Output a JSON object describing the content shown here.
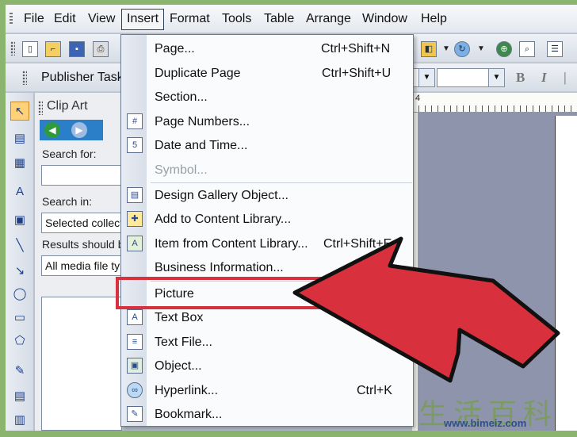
{
  "menubar": {
    "items": [
      "File",
      "Edit",
      "View",
      "Insert",
      "Format",
      "Tools",
      "Table",
      "Arrange",
      "Window",
      "Help"
    ],
    "underline": [
      "F",
      "E",
      "V",
      "I",
      "o",
      "T",
      "a",
      "r",
      "W",
      "H"
    ],
    "active": "Insert"
  },
  "toolbar": {
    "publisher_tasks": "Publisher Tasks",
    "bold_label": "B",
    "italic_label": "I"
  },
  "taskpane": {
    "title": "Clip Art",
    "search_for_label": "Search for:",
    "search_value": "",
    "search_in_label": "Search in:",
    "search_in_value": "Selected collect",
    "results_label": "Results should b",
    "results_value": "All media file ty"
  },
  "ruler": {
    "visible_number": "4"
  },
  "insert_menu": {
    "items": [
      {
        "label": "Page...",
        "shortcut": "Ctrl+Shift+N",
        "icon": "",
        "disabled": false
      },
      {
        "label": "Duplicate Page",
        "shortcut": "Ctrl+Shift+U",
        "icon": "",
        "disabled": false
      },
      {
        "label": "Section...",
        "shortcut": "",
        "icon": "",
        "disabled": false
      },
      {
        "label": "Page Numbers...",
        "shortcut": "",
        "icon": "page-number-icon",
        "disabled": false
      },
      {
        "label": "Date and Time...",
        "shortcut": "",
        "icon": "date-time-icon",
        "disabled": false
      },
      {
        "label": "Symbol...",
        "shortcut": "",
        "icon": "",
        "disabled": true
      },
      {
        "label": "Design Gallery Object...",
        "shortcut": "",
        "icon": "design-gallery-icon",
        "disabled": false
      },
      {
        "label": "Add to Content Library...",
        "shortcut": "",
        "icon": "add-content-library-icon",
        "disabled": false
      },
      {
        "label": "Item from Content Library...",
        "shortcut": "Ctrl+Shift+E",
        "icon": "content-library-item-icon",
        "disabled": false
      },
      {
        "label": "Business Information...",
        "shortcut": "",
        "icon": "",
        "disabled": false
      },
      {
        "label": "Picture",
        "shortcut": "",
        "icon": "",
        "disabled": false
      },
      {
        "label": "Text Box",
        "shortcut": "",
        "icon": "text-box-icon",
        "disabled": false
      },
      {
        "label": "Text File...",
        "shortcut": "",
        "icon": "text-file-icon",
        "disabled": false
      },
      {
        "label": "Object...",
        "shortcut": "",
        "icon": "object-icon",
        "disabled": false
      },
      {
        "label": "Hyperlink...",
        "shortcut": "Ctrl+K",
        "icon": "hyperlink-icon",
        "disabled": false
      },
      {
        "label": "Bookmark...",
        "shortcut": "",
        "icon": "bookmark-icon",
        "disabled": false
      }
    ],
    "highlighted": "Picture"
  },
  "annotation": {
    "arrow_color": "#d8313d",
    "highlight_color": "#d8313d"
  },
  "watermark": {
    "chinese": "生活百科",
    "url": "www.bimeiz.com"
  }
}
